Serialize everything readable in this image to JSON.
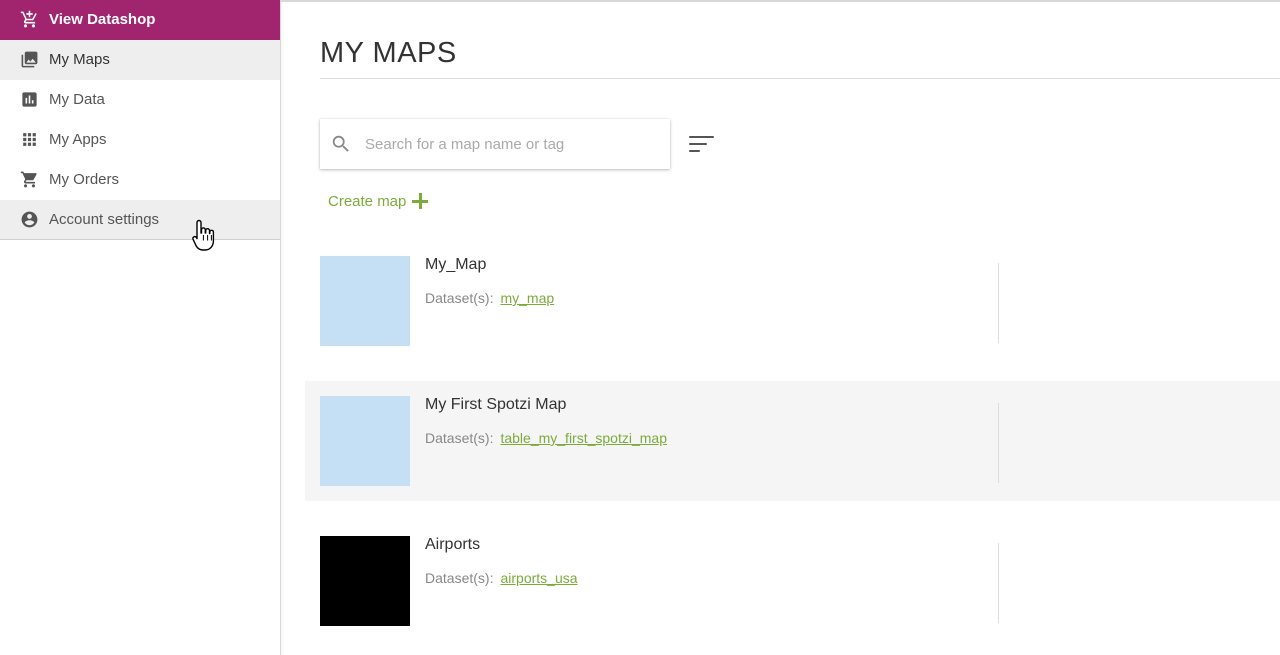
{
  "sidebar": {
    "items": [
      {
        "label": "View Datashop",
        "icon": "cart-plus-icon"
      },
      {
        "label": "My Maps",
        "icon": "image-icon"
      },
      {
        "label": "My Data",
        "icon": "bar-chart-icon"
      },
      {
        "label": "My Apps",
        "icon": "grid-icon"
      },
      {
        "label": "My Orders",
        "icon": "cart-icon"
      },
      {
        "label": "Account settings",
        "icon": "account-circle-icon"
      }
    ]
  },
  "main": {
    "title": "MY MAPS",
    "search": {
      "placeholder": "Search for a map name or tag",
      "value": ""
    },
    "create_map_label": "Create map",
    "dataset_label": "Dataset(s):",
    "maps": [
      {
        "name": "My_Map",
        "dataset": "my_map",
        "thumb_color": "#c5dff5"
      },
      {
        "name": "My First Spotzi Map",
        "dataset": "table_my_first_spotzi_map",
        "thumb_color": "#c5dff5"
      },
      {
        "name": "Airports",
        "dataset": "airports_usa",
        "thumb_color": "#000000"
      }
    ]
  },
  "colors": {
    "brand": "#a0246e",
    "accent": "#7cab3c"
  }
}
